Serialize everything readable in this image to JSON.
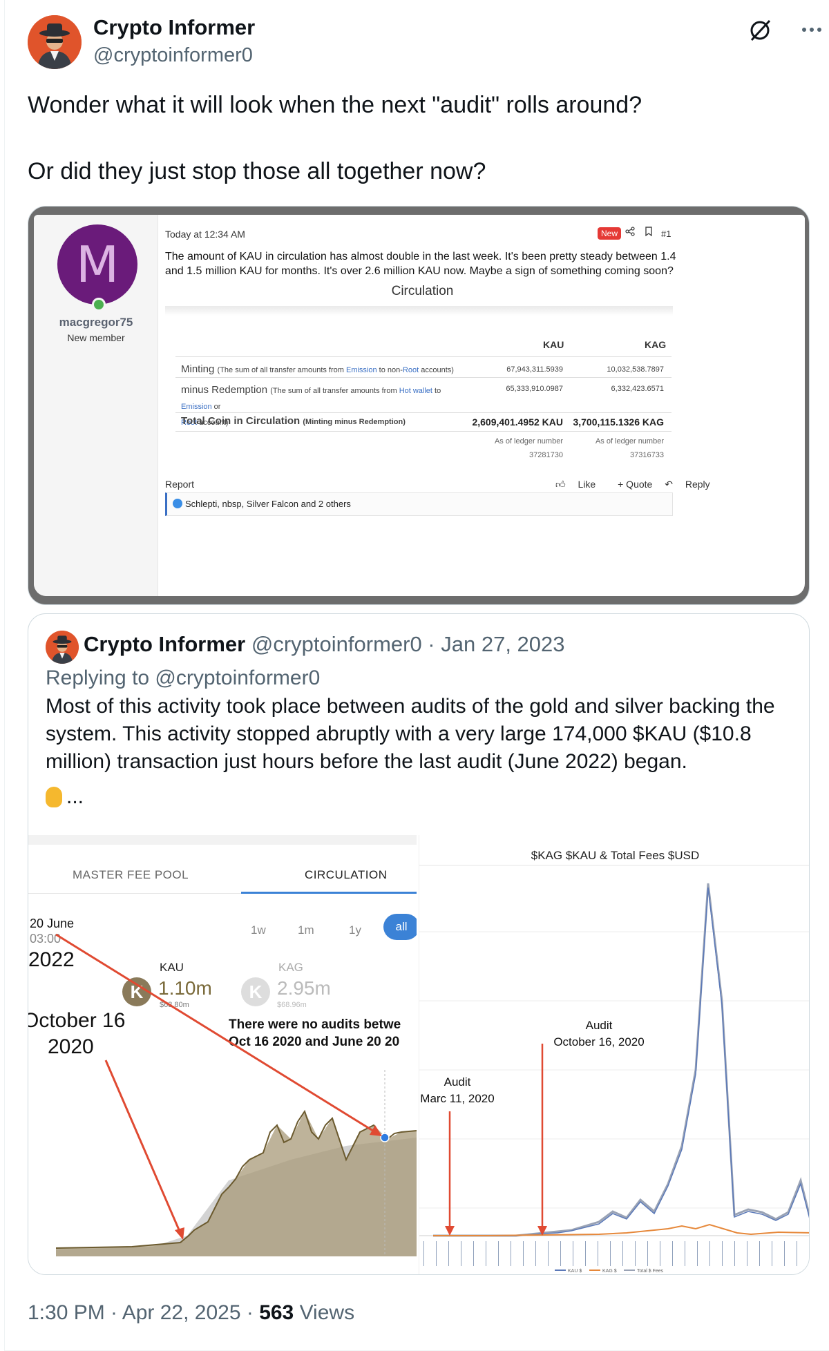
{
  "author": {
    "display_name": "Crypto Informer",
    "handle": "@cryptoinformer0"
  },
  "tweet": {
    "line1": "Wonder what it will look when the next \"audit\" rolls around?",
    "line2": "Or did they just stop those all together now?"
  },
  "forum": {
    "avatar_letter": "M",
    "username": "macgregor75",
    "role": "New member",
    "time": "Today at 12:34 AM",
    "badge": "New",
    "post_number": "#1",
    "body": "The amount of KAU in circulation has almost double in the last week. It's been pretty steady between 1.4 and 1.5 million KAU for months. It's over 2.6 million KAU now. Maybe a sign of something coming soon?",
    "circulation_title": "Circulation",
    "table": {
      "col_kau": "KAU",
      "col_kag": "KAG",
      "minting_label": "Minting",
      "minting_note_a": "(The sum of all transfer amounts from ",
      "minting_note_emission": "Emission",
      "minting_note_b": " to non-",
      "minting_note_root": "Root",
      "minting_note_c": " accounts)",
      "minting_kau": "67,943,311.5939",
      "minting_kag": "10,032,538.7897",
      "redemption_label": "minus Redemption",
      "redemption_note_a": "(The sum of all transfer amounts from ",
      "redemption_note_hot": "Hot wallet",
      "redemption_note_b": " to ",
      "redemption_note_emission": "Emission",
      "redemption_note_c": " or",
      "redemption_note_root": "Root",
      "redemption_note_d": " account)",
      "redemption_kau": "65,333,910.0987",
      "redemption_kag": "6,332,423.6571",
      "total_label": "Total Coin in Circulation",
      "total_note": "(Minting minus Redemption)",
      "total_kau": "2,609,401.4952 KAU",
      "total_kag": "3,700,115.1326 KAG",
      "ledger_note": "As of ledger number",
      "ledger_kau": "37281730",
      "ledger_kag": "37316733"
    },
    "report": "Report",
    "like": "Like",
    "quote": "+ Quote",
    "reply": "Reply",
    "reactions": "Schlepti, nbsp, Silver Falcon and 2 others"
  },
  "quoted": {
    "display_name": "Crypto Informer",
    "meta": "@cryptoinformer0 · Jan 27, 2023",
    "replying_to": "Replying to @cryptoinformer0",
    "text": "Most of this activity took place between audits of the gold and silver backing the system. This activity stopped abruptly with a very large 174,000 $KAU ($10.8 million) transaction just hours before the last audit (June 2022) began.",
    "ellipsis": "...",
    "left_chart": {
      "tab1": "MASTER FEE POOL",
      "tab2": "CIRCULATION",
      "ranges": [
        "1w",
        "1m",
        "1y",
        "all"
      ],
      "date_label": "20 June",
      "time_label": "03:00",
      "year_label": "2022",
      "kau_label": "KAU",
      "kau_value": "1.10m",
      "kau_sub": "$63.80m",
      "kag_label": "KAG",
      "kag_value": "2.95m",
      "kag_sub": "$68.96m",
      "oct_label": "October 16",
      "oct_year": "2020",
      "annotation_line1": "There were no audits betwe",
      "annotation_line2": "Oct 16 2020 and June 20 20"
    },
    "right_chart": {
      "title": "$KAG $KAU & Total Fees $USD",
      "audit2_line1": "Audit",
      "audit2_line2": "October 16, 2020",
      "audit1_line1": "Audit",
      "audit1_line2": "Marc 11, 2020",
      "legend": [
        "KAU $",
        "KAG $",
        "Total $ Fees"
      ]
    }
  },
  "footer": {
    "time": "1:30 PM · Apr 22, 2025 · ",
    "views_count": "563",
    "views_label": " Views"
  },
  "colors": {
    "accent_blue": "#3b82d6",
    "arrow_red": "#e04a32",
    "new_badge": "#e53935"
  },
  "chart_data": [
    {
      "type": "area",
      "title": "",
      "series": [
        {
          "name": "KAU",
          "values": []
        }
      ]
    },
    {
      "type": "line",
      "title": "$KAG $KAU & Total Fees $USD",
      "series": [
        {
          "name": "KAU $",
          "values": []
        },
        {
          "name": "KAG $",
          "values": []
        },
        {
          "name": "Total $ Fees",
          "values": []
        }
      ]
    }
  ]
}
